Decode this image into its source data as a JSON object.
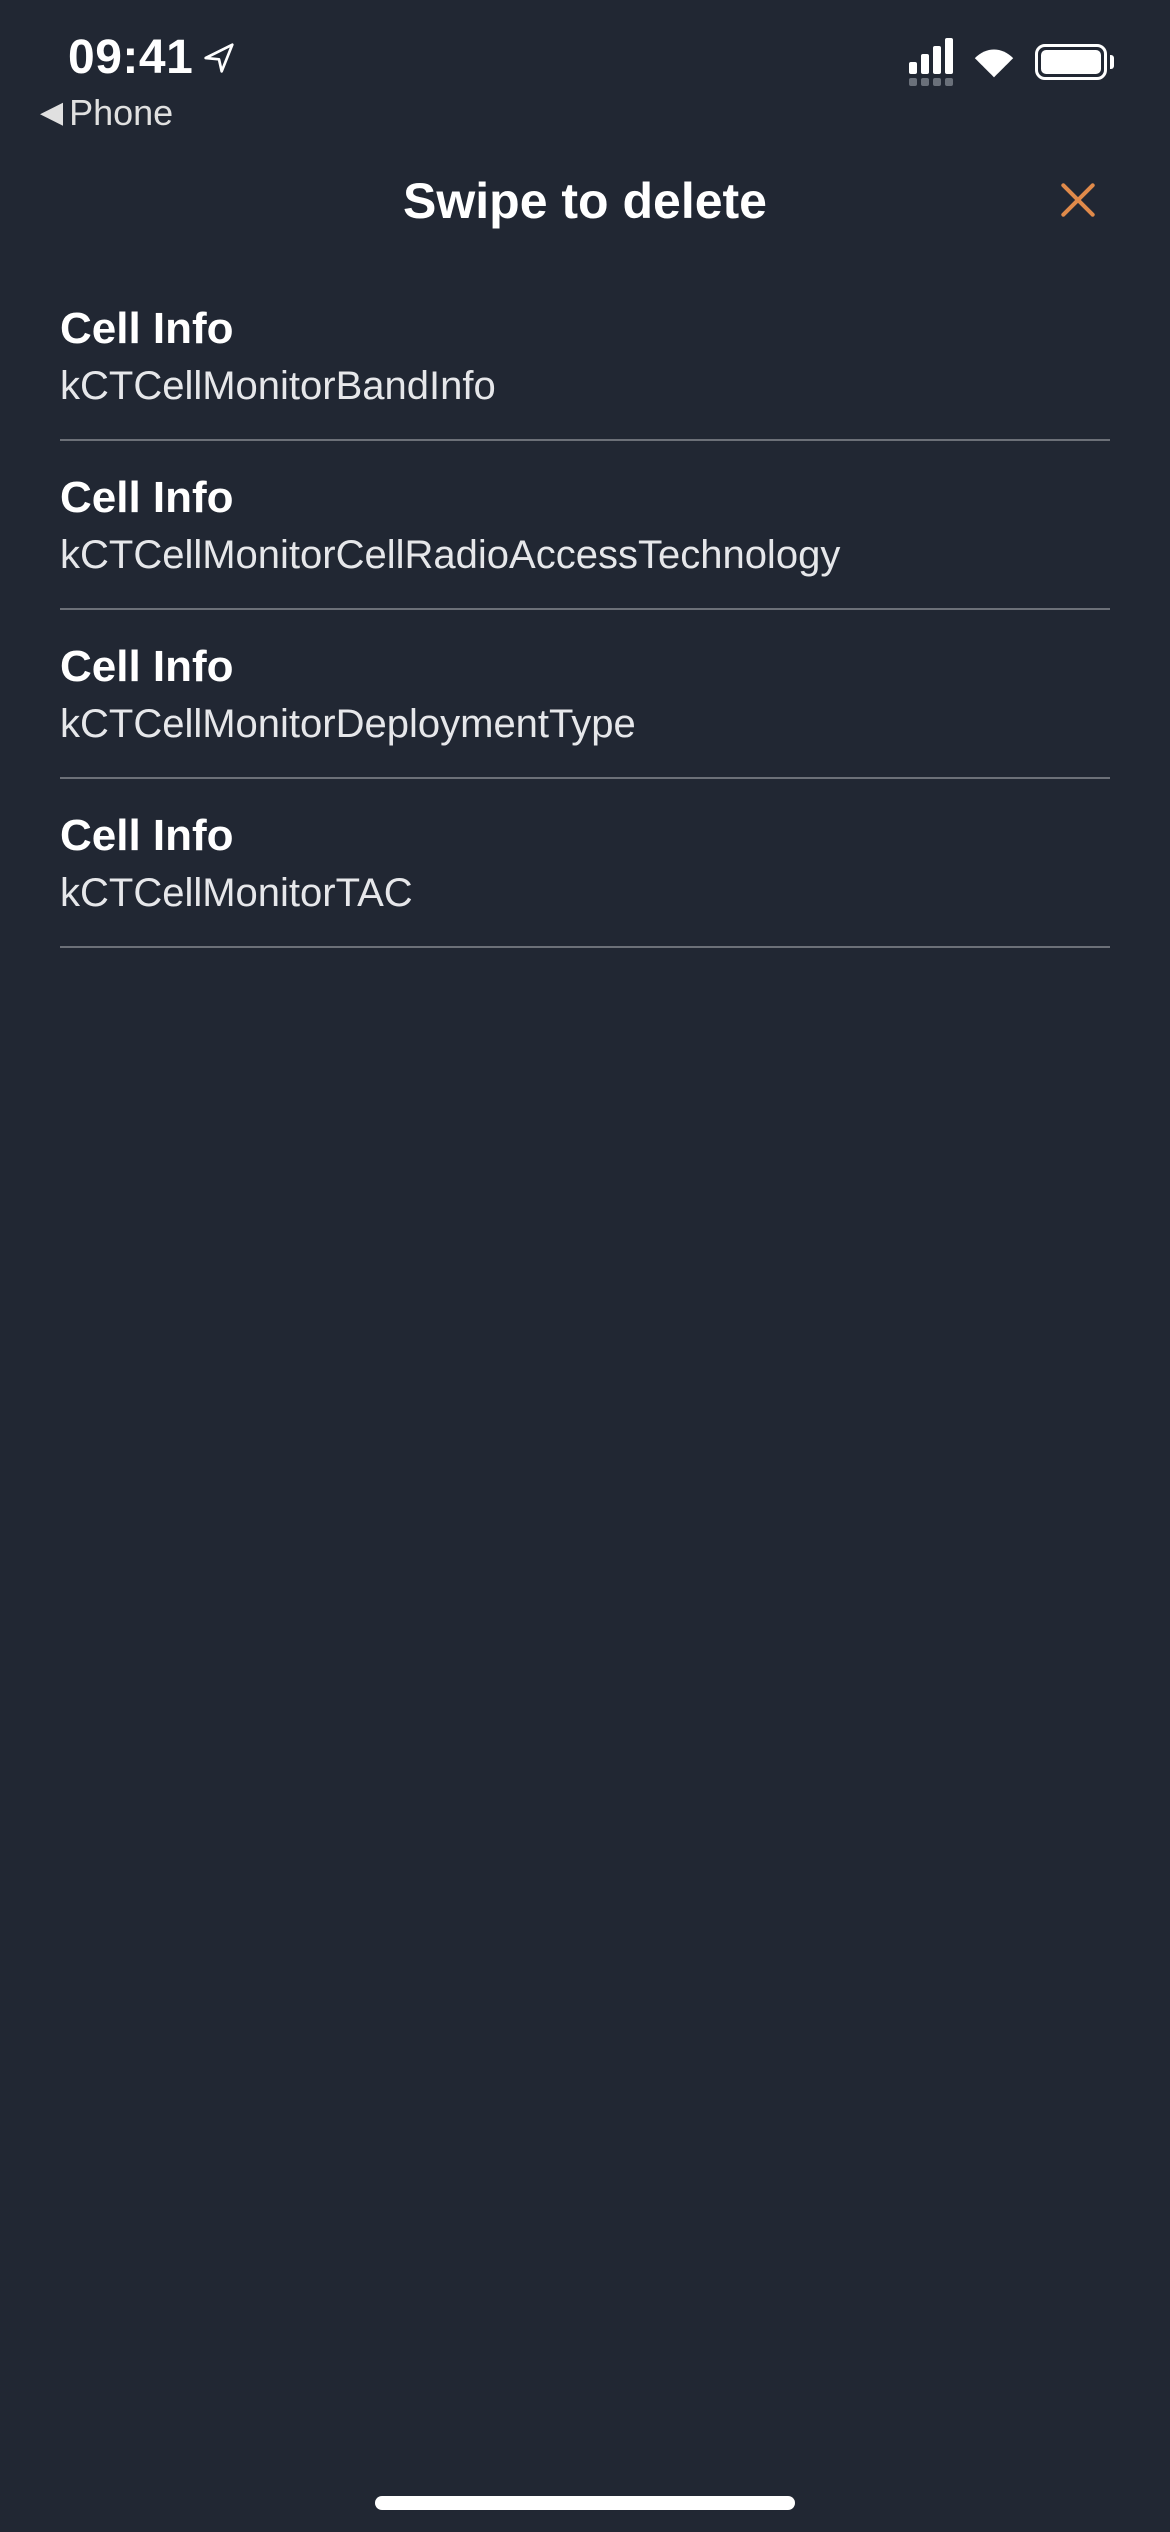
{
  "colors": {
    "accent": "#e08a4a",
    "background": "#212733",
    "text": "#ffffff",
    "divider": "#6c7078"
  },
  "status": {
    "time": "09:41",
    "back_label": "Phone"
  },
  "header": {
    "title": "Swipe to delete"
  },
  "list": {
    "items": [
      {
        "title": "Cell Info",
        "subtitle": "kCTCellMonitorBandInfo"
      },
      {
        "title": "Cell Info",
        "subtitle": "kCTCellMonitorCellRadioAccessTechnology"
      },
      {
        "title": "Cell Info",
        "subtitle": "kCTCellMonitorDeploymentType"
      },
      {
        "title": "Cell Info",
        "subtitle": "kCTCellMonitorTAC"
      }
    ]
  }
}
